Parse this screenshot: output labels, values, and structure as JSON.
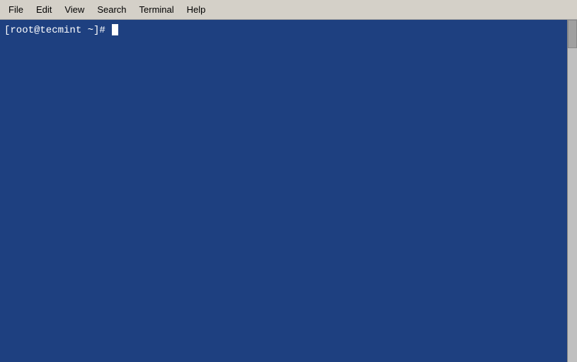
{
  "menubar": {
    "items": [
      {
        "id": "file",
        "label": "File"
      },
      {
        "id": "edit",
        "label": "Edit"
      },
      {
        "id": "view",
        "label": "View"
      },
      {
        "id": "search",
        "label": "Search"
      },
      {
        "id": "terminal",
        "label": "Terminal"
      },
      {
        "id": "help",
        "label": "Help"
      }
    ]
  },
  "terminal": {
    "prompt": "[root@tecmint ~]# "
  }
}
